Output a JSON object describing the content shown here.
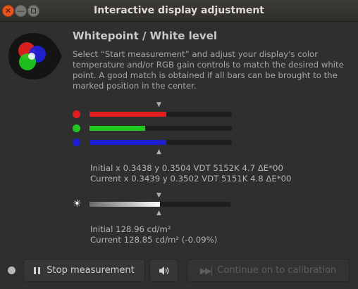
{
  "window": {
    "title": "Interactive display adjustment",
    "controls": [
      "close",
      "minimize",
      "maximize"
    ]
  },
  "logo": {
    "icon": "rgb-circles-icon"
  },
  "heading": "Whitepoint / White level",
  "instructions": "Select “Start measurement” and adjust your display's color temperature and/or RGB gain controls to match the desired white point. A good match is obtained if all bars can be brought to the marked position in the center.",
  "rgb_bars": [
    {
      "channel": "red",
      "color": "#e01e1e",
      "level": 0.54
    },
    {
      "channel": "green",
      "color": "#1ec81e",
      "level": 0.39
    },
    {
      "channel": "blue",
      "color": "#1e1ed2",
      "level": 0.54
    }
  ],
  "chromaticity": {
    "initial": "Initial x 0.3438 y 0.3504 VDT 5152K 4.7 ΔE*00",
    "current": "Current x 0.3439 y 0.3502 VDT 5151K 4.8 ΔE*00"
  },
  "luminance_bar": {
    "icon": "brightness-icon",
    "level": 0.5
  },
  "luminance": {
    "initial": "Initial 128.96 cd/m²",
    "current": "Current 128.85 cd/m² (-0.09%)"
  },
  "buttons": {
    "stop": "Stop measurement",
    "sound": "speaker-icon",
    "continue": "Continue on to calibration"
  }
}
